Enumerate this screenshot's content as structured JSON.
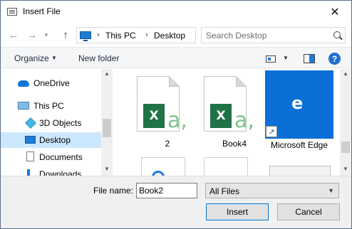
{
  "window": {
    "title": "Insert File",
    "close_symbol": "✕"
  },
  "nav": {
    "back_symbol": "←",
    "forward_symbol": "→",
    "recent_symbol": "▾",
    "up_symbol": "↑"
  },
  "address": {
    "separator": "›",
    "segments": [
      "This PC",
      "Desktop"
    ],
    "refresh_symbol": "↻"
  },
  "search": {
    "placeholder": "Search Desktop"
  },
  "toolbar": {
    "organize_label": "Organize",
    "dropdown_symbol": "▼",
    "new_folder_label": "New folder",
    "help_symbol": "?"
  },
  "sidebar": {
    "items": [
      {
        "label": "OneDrive",
        "icon": "onedrive-icon"
      },
      {
        "label": "This PC",
        "icon": "computer-icon"
      },
      {
        "label": "3D Objects",
        "icon": "3d-objects-icon"
      },
      {
        "label": "Desktop",
        "icon": "desktop-icon",
        "selected": true
      },
      {
        "label": "Documents",
        "icon": "documents-icon"
      },
      {
        "label": "Downloads",
        "icon": "downloads-icon"
      }
    ]
  },
  "scrollbar": {
    "up_symbol": "▲",
    "down_symbol": "▼"
  },
  "files": [
    {
      "name": "2",
      "type": "excel-workbook",
      "badge": "X",
      "letter": "a,"
    },
    {
      "name": "Book4",
      "type": "excel-workbook",
      "badge": "X",
      "letter": "a,"
    },
    {
      "name": "Microsoft Edge",
      "type": "shortcut",
      "icon_letter": "e",
      "shortcut_symbol": "↗"
    }
  ],
  "footer": {
    "file_name_label": "File name:",
    "file_name_value": "Book2",
    "file_type_value": "All Files",
    "insert_label": "Insert",
    "cancel_label": "Cancel"
  },
  "colors": {
    "accent": "#0078d7",
    "excel_green": "#1f7346",
    "edge_blue": "#0a6fd6",
    "selected_bg": "#cce8ff"
  }
}
